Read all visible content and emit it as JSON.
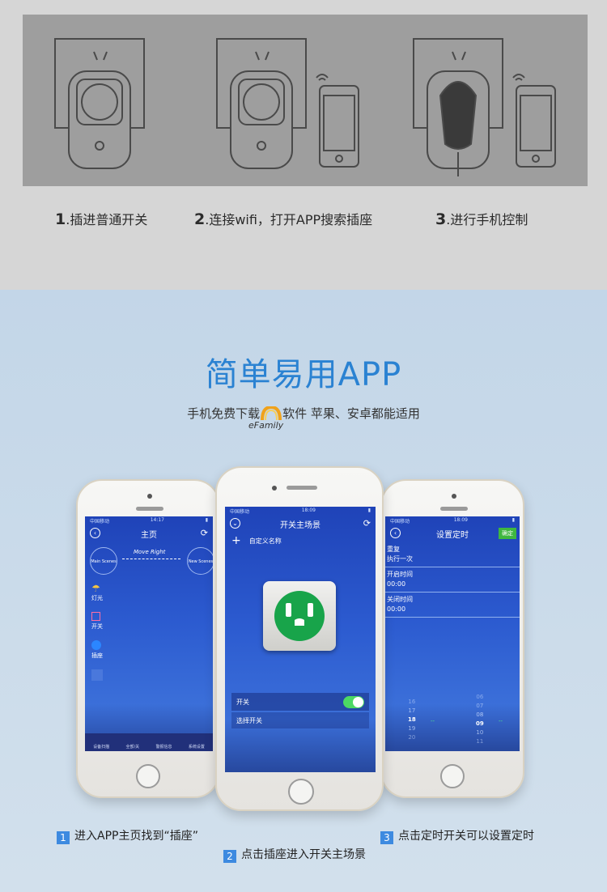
{
  "steps": [
    {
      "num": "1",
      "text": ".插进普通开关"
    },
    {
      "num": "2",
      "text": ".连接wifi，打开APP搜索插座"
    },
    {
      "num": "3",
      "text": ".进行手机控制"
    }
  ],
  "headline": "简单易用APP",
  "subline": {
    "before": "手机免费下载",
    "after": "软件 苹果、安卓都能适用",
    "logo_text": "eFamily"
  },
  "phone_left": {
    "status_left": "中国移动",
    "status_time": "14:17",
    "title": "主页",
    "scene_a": "Main Scenes",
    "move_right": "Move Right",
    "scene_b": "New Scenes",
    "items": [
      "灯光",
      "开关",
      "插座"
    ],
    "tabs": [
      "设备扫描",
      "全部/关",
      "警报信息",
      "系统设置"
    ]
  },
  "phone_center": {
    "status_left": "中国移动",
    "status_time": "18:09",
    "title": "开关主场景",
    "custom_name": "自定义名称",
    "switch_label": "开关",
    "select_label": "选择开关"
  },
  "phone_right": {
    "status_left": "中国移动",
    "status_time": "18:09",
    "title": "设置定时",
    "confirm": "确定",
    "rows": [
      {
        "label": "重复",
        "value": "执行一次"
      },
      {
        "label": "开启时间",
        "value": "00:00"
      },
      {
        "label": "关闭时间",
        "value": "00:00"
      }
    ],
    "picker_hours": [
      "16",
      "17",
      "18",
      "19",
      "20"
    ],
    "picker_minutes": [
      "06",
      "07",
      "08",
      "09",
      "10",
      "11"
    ],
    "picker_selected_hour": "18",
    "picker_selected_minute": "09"
  },
  "captions": [
    {
      "num": "1",
      "text": "进入APP主页找到“插座”"
    },
    {
      "num": "2",
      "text": "点击插座进入开关主场景"
    },
    {
      "num": "3",
      "text": "点击定时开关可以设置定时"
    }
  ],
  "colors": {
    "top_bg": "#d6d6d6",
    "panel_bg": "#9e9e9e",
    "headline": "#2a82d2",
    "badge": "#3d8ae0",
    "screen_blue": "#2c5bd0",
    "toggle_green": "#4cd964",
    "socket_green": "#18a44a"
  }
}
